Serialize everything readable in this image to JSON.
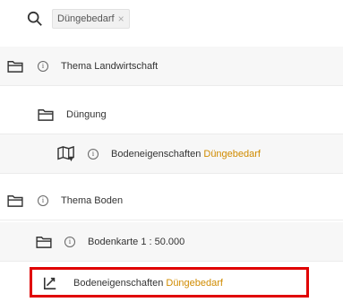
{
  "search": {
    "chip_label": "Düngebedarf",
    "chip_close": "×"
  },
  "tree": {
    "thema_landwirtschaft": "Thema Landwirtschaft",
    "duengung": "Düngung",
    "bodeneigenschaften_1_prefix": "Bodeneigenschaften",
    "bodeneigenschaften_1_highlight": "Düngebedarf",
    "thema_boden": "Thema Boden",
    "bodenkarte": "Bodenkarte 1 : 50.000",
    "bodeneigenschaften_2_prefix": "Bodeneigenschaften",
    "bodeneigenschaften_2_highlight": "Düngebedarf"
  },
  "info_glyph": "i",
  "colors": {
    "highlight_text": "#d08b00",
    "highlight_box": "#e00000",
    "shaded_row": "#f7f7f7"
  },
  "icons": [
    "search-icon",
    "folder-icon",
    "info-icon",
    "map-icon",
    "line-chart-icon"
  ]
}
